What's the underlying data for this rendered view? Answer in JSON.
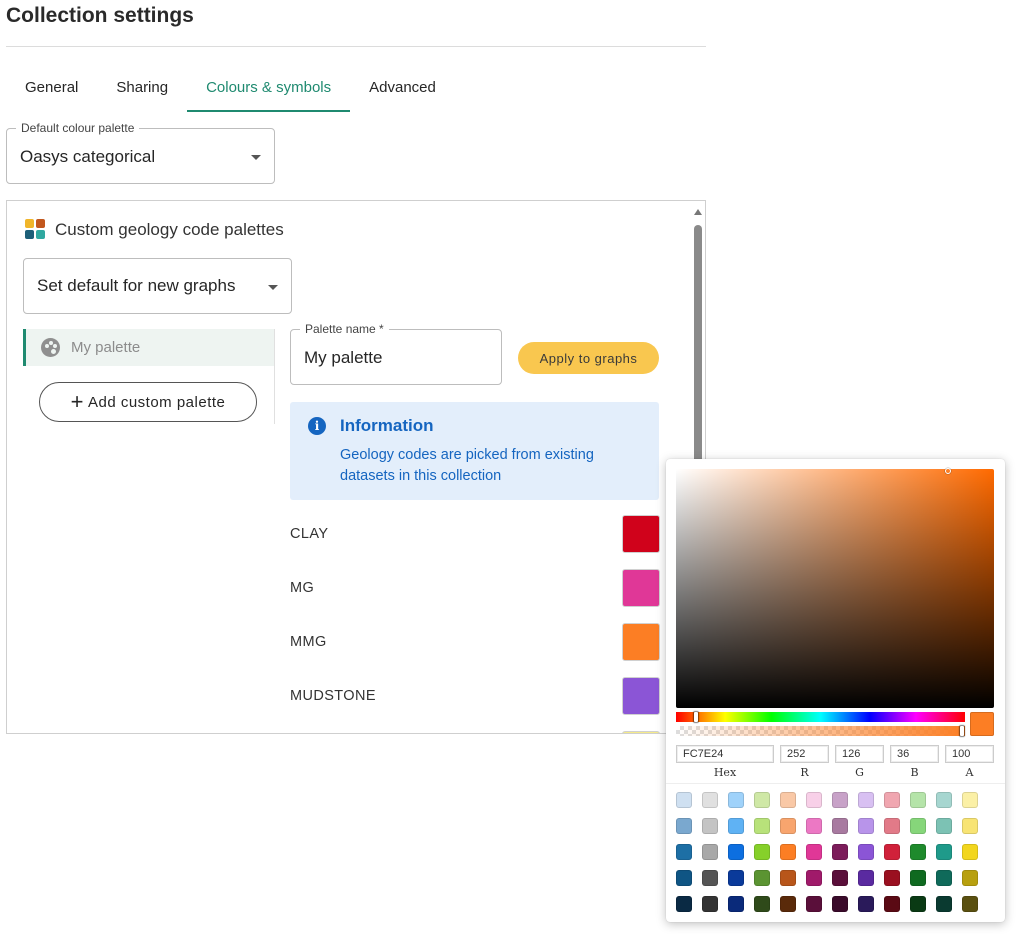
{
  "page": {
    "title": "Collection settings"
  },
  "tabs": [
    {
      "label": "General",
      "active": false
    },
    {
      "label": "Sharing",
      "active": false
    },
    {
      "label": "Colours & symbols",
      "active": true
    },
    {
      "label": "Advanced",
      "active": false
    }
  ],
  "default_palette": {
    "legend": "Default colour palette",
    "value": "Oasys categorical"
  },
  "custom_section": {
    "title": "Custom geology code palettes",
    "icon": "palette-grid-icon",
    "icon_colors": [
      "#f0b52a",
      "#c2571d",
      "#1d5f78",
      "#2fa8a0"
    ],
    "dropdown_value": "Set default for new graphs",
    "palettes": [
      {
        "label": "My palette",
        "icon": "palette-icon",
        "selected": true
      }
    ],
    "add_button": "Add custom palette",
    "palette_name": {
      "legend": "Palette name *",
      "value": "My palette"
    },
    "apply_button": "Apply to graphs",
    "info": {
      "icon": "info-icon",
      "title": "Information",
      "text": "Geology codes are picked from existing datasets in this collection"
    },
    "codes": [
      {
        "label": "CLAY",
        "color": "#d0021b"
      },
      {
        "label": "MG",
        "color": "#e03797"
      },
      {
        "label": "MMG",
        "color": "#fc7e24"
      },
      {
        "label": "MUDSTONE",
        "color": "#8b55d6"
      },
      {
        "label": "",
        "color": "#f5ea8a"
      }
    ]
  },
  "color_picker": {
    "current_color": "#fc7e24",
    "hue_color": "#ff6a00",
    "hex": "FC7E24",
    "r": "252",
    "g": "126",
    "b": "36",
    "a": "100",
    "labels": {
      "hex": "Hex",
      "r": "R",
      "g": "G",
      "b": "B",
      "a": "A"
    },
    "presets": [
      [
        "#cfe0f1",
        "#e0e0e0",
        "#9fd2fa",
        "#cfe8a6",
        "#f9c8a6",
        "#f8d0e8",
        "#c8a2c8",
        "#d8c0f2",
        "#f0a6b0",
        "#b5e4a9",
        "#a6d6d0",
        "#fbf0a6"
      ],
      [
        "#7aa8cf",
        "#c4c4c4",
        "#5fb2f4",
        "#b8e27a",
        "#f8a56e",
        "#ec78c4",
        "#a87aa0",
        "#b894ea",
        "#e27a88",
        "#86d67a",
        "#7cc2b4",
        "#f8e474"
      ],
      [
        "#1d6fa5",
        "#a8a8a8",
        "#0d6fe0",
        "#86d02a",
        "#fc7e24",
        "#e03797",
        "#7c1c5a",
        "#8b55d6",
        "#d0213a",
        "#1e8a2c",
        "#1f9a8a",
        "#f2d61e"
      ],
      [
        "#0f5584",
        "#555555",
        "#0a3a9a",
        "#5b9432",
        "#b8561a",
        "#a01a6a",
        "#5a0f3a",
        "#5a2aa0",
        "#9a1020",
        "#0f6a20",
        "#0f6a5a",
        "#b8a00f"
      ],
      [
        "#0a2a44",
        "#333333",
        "#0a2a7a",
        "#2f4a1a",
        "#5a2a0a",
        "#5a0f3a",
        "#3a0a2a",
        "#2a1a5a",
        "#5a0a14",
        "#0a3a14",
        "#0a3a30",
        "#5a5010"
      ]
    ]
  }
}
